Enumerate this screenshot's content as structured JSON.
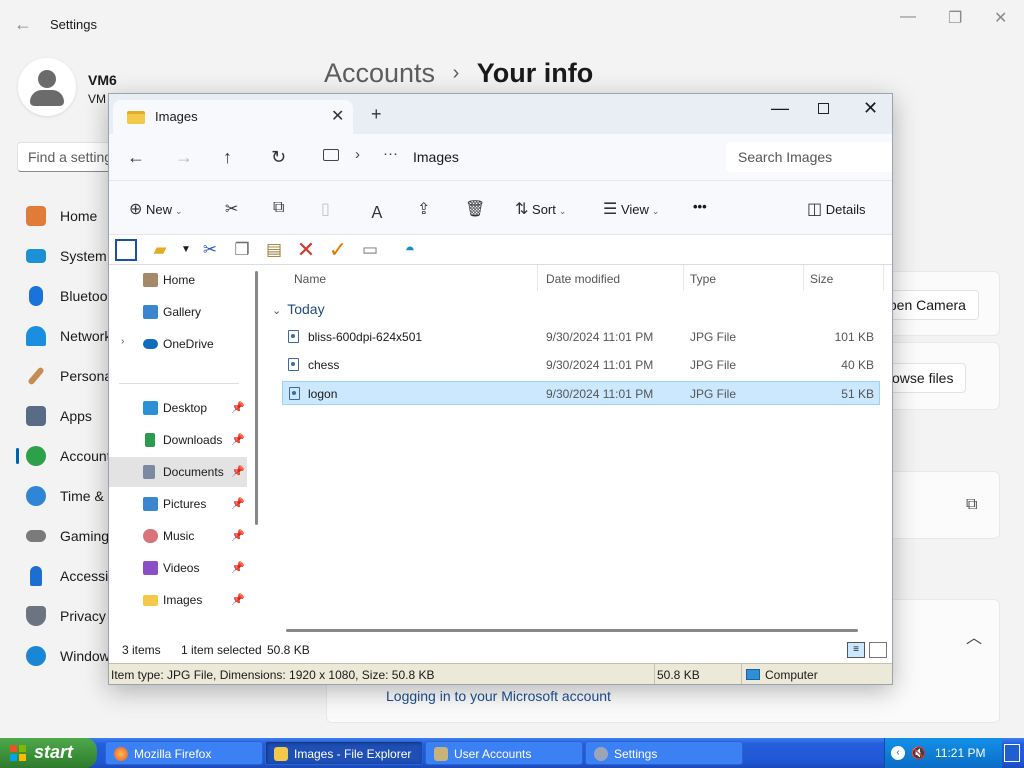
{
  "settings": {
    "title": "Settings",
    "user_name": "VM6",
    "user_sub": "VM",
    "search_placeholder": "Find a setting",
    "breadcrumb_parent": "Accounts",
    "breadcrumb_sep": "›",
    "breadcrumb_current": "Your info",
    "nav": [
      {
        "label": "Home",
        "icon": "home-icon"
      },
      {
        "label": "System",
        "icon": "system-icon"
      },
      {
        "label": "Bluetoo",
        "icon": "bluetooth-icon"
      },
      {
        "label": "Network",
        "icon": "network-icon"
      },
      {
        "label": "Persona",
        "icon": "personalization-icon"
      },
      {
        "label": "Apps",
        "icon": "apps-icon"
      },
      {
        "label": "Account",
        "icon": "accounts-icon"
      },
      {
        "label": "Time &",
        "icon": "time-icon"
      },
      {
        "label": "Gaming",
        "icon": "gaming-icon"
      },
      {
        "label": "Accessil",
        "icon": "accessibility-icon"
      },
      {
        "label": "Privacy",
        "icon": "privacy-icon"
      },
      {
        "label": "Window",
        "icon": "windows-update-icon"
      }
    ],
    "open_camera": "Open Camera",
    "browse_files": "Browse files",
    "ms_link": "Logging in to your Microsoft account"
  },
  "explorer": {
    "tab_title": "Images",
    "address": "Images",
    "search_placeholder": "Search Images",
    "commands": {
      "new": "New",
      "sort": "Sort",
      "view": "View",
      "more": "•••",
      "details": "Details"
    },
    "nav": [
      {
        "label": "Home",
        "icon": "home-icon"
      },
      {
        "label": "Gallery",
        "icon": "gallery-icon"
      },
      {
        "label": "OneDrive",
        "icon": "onedrive-icon"
      },
      {
        "label": "Desktop",
        "icon": "desktop-icon"
      },
      {
        "label": "Downloads",
        "icon": "downloads-icon"
      },
      {
        "label": "Documents",
        "icon": "documents-icon"
      },
      {
        "label": "Pictures",
        "icon": "pictures-icon"
      },
      {
        "label": "Music",
        "icon": "music-icon"
      },
      {
        "label": "Videos",
        "icon": "videos-icon"
      },
      {
        "label": "Images",
        "icon": "folder-icon"
      }
    ],
    "columns": {
      "name": "Name",
      "date": "Date modified",
      "type": "Type",
      "size": "Size"
    },
    "group": "Today",
    "files": [
      {
        "name": "bliss-600dpi-624x501",
        "date": "9/30/2024 11:01 PM",
        "type": "JPG File",
        "size": "101 KB"
      },
      {
        "name": "chess",
        "date": "9/30/2024 11:01 PM",
        "type": "JPG File",
        "size": "40 KB"
      },
      {
        "name": "logon",
        "date": "9/30/2024 11:01 PM",
        "type": "JPG File",
        "size": "51 KB"
      }
    ],
    "status": {
      "items": "3 items",
      "selected": "1 item selected",
      "size": "50.8 KB"
    },
    "xp_status": {
      "info": "Item type: JPG File, Dimensions: 1920 x 1080, Size: 50.8 KB",
      "size": "50.8 KB",
      "location": "Computer"
    }
  },
  "taskbar": {
    "start": "start",
    "tasks": [
      {
        "label": "Mozilla Firefox",
        "icon": "firefox-icon"
      },
      {
        "label": "Images - File Explorer",
        "icon": "folder-icon"
      },
      {
        "label": "User Accounts",
        "icon": "user-accounts-icon"
      },
      {
        "label": "Settings",
        "icon": "settings-icon"
      }
    ],
    "clock": "11:21 PM"
  }
}
